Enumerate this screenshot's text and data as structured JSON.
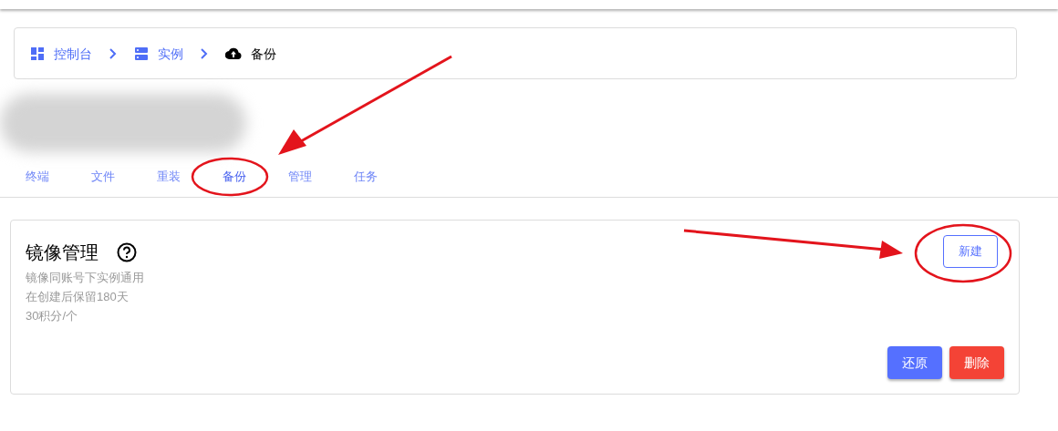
{
  "breadcrumb": [
    {
      "kind": "grid",
      "label": "控制台"
    },
    {
      "kind": "server",
      "label": "实例"
    },
    {
      "kind": "cloud",
      "label": "备份"
    }
  ],
  "tabs": [
    {
      "label": "终端",
      "selected": false
    },
    {
      "label": "文件",
      "selected": false
    },
    {
      "label": "重装",
      "selected": false
    },
    {
      "label": "备份",
      "selected": true
    },
    {
      "label": "管理",
      "selected": false
    },
    {
      "label": "任务",
      "selected": false
    }
  ],
  "panel": {
    "title": "镜像管理",
    "notes": [
      "镜像同账号下实例通用",
      "在创建后保留180天",
      "30积分/个"
    ],
    "new_button": "新建",
    "actions": [
      {
        "kind": "primary",
        "label": "还原"
      },
      {
        "kind": "danger",
        "label": "删除"
      }
    ]
  }
}
